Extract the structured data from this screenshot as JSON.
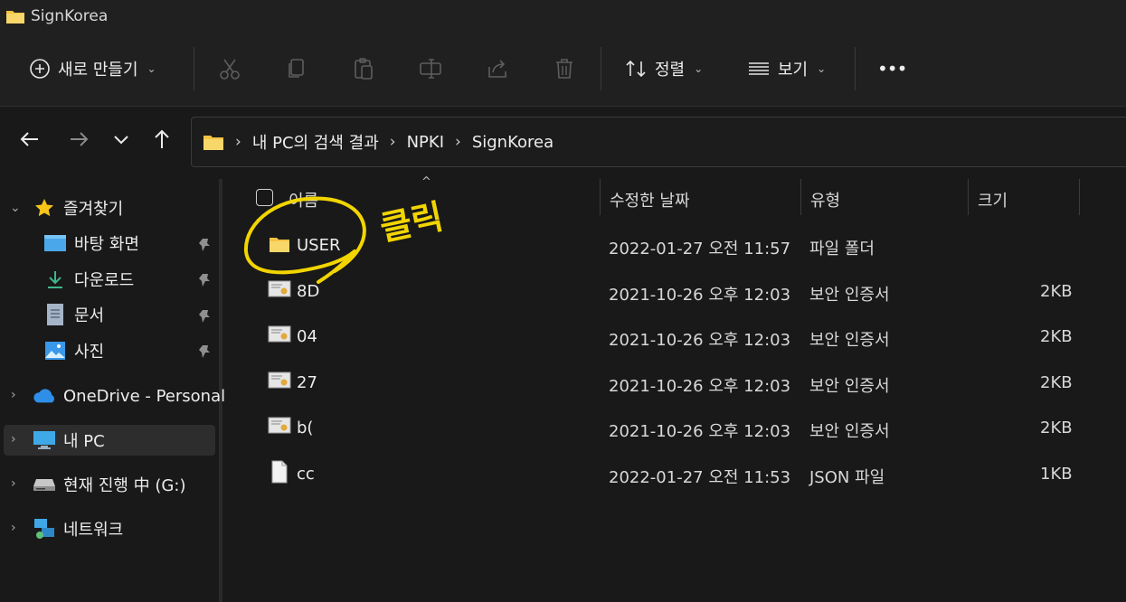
{
  "window": {
    "title": "SignKorea"
  },
  "toolbar": {
    "new_label": "새로 만들기",
    "sort_label": "정렬",
    "view_label": "보기",
    "more_label": "•••"
  },
  "address": {
    "crumbs": [
      "내 PC의 검색 결과",
      "NPKI",
      "SignKorea"
    ],
    "separator": "›"
  },
  "sidebar": {
    "favorites_label": "즐겨찾기",
    "favorites": [
      {
        "label": "바탕 화면",
        "icon": "desktop-icon"
      },
      {
        "label": "다운로드",
        "icon": "download-icon"
      },
      {
        "label": "문서",
        "icon": "document-icon"
      },
      {
        "label": "사진",
        "icon": "pictures-icon"
      }
    ],
    "onedrive_label": "OneDrive - Personal",
    "thispc_label": "내 PC",
    "drive_label": "현재 진행 中 (G:)",
    "network_label": "네트워크"
  },
  "columns": {
    "name": "이름",
    "modified": "수정한 날짜",
    "type": "유형",
    "size": "크기"
  },
  "files": [
    {
      "name": "USER",
      "date": "2022-01-27 오전 11:57",
      "type": "파일 폴더",
      "size": "",
      "icon": "folder-icon"
    },
    {
      "name": "8D",
      "date": "2021-10-26 오후 12:03",
      "type": "보안 인증서",
      "size": "2KB",
      "icon": "certificate-icon"
    },
    {
      "name": "04",
      "date": "2021-10-26 오후 12:03",
      "type": "보안 인증서",
      "size": "2KB",
      "icon": "certificate-icon"
    },
    {
      "name": "27",
      "date": "2021-10-26 오후 12:03",
      "type": "보안 인증서",
      "size": "2KB",
      "icon": "certificate-icon"
    },
    {
      "name": "b(",
      "date": "2021-10-26 오후 12:03",
      "type": "보안 인증서",
      "size": "2KB",
      "icon": "certificate-icon"
    },
    {
      "name": "cc",
      "date": "2022-01-27 오전 11:53",
      "type": "JSON 파일",
      "size": "1KB",
      "icon": "file-icon"
    }
  ],
  "annotation": {
    "text": "클릭",
    "color": "#f2d500"
  },
  "colors": {
    "folder": "#f3c343",
    "accent": "#4cc2ff",
    "background": "#191919",
    "toolbar": "#202020"
  }
}
